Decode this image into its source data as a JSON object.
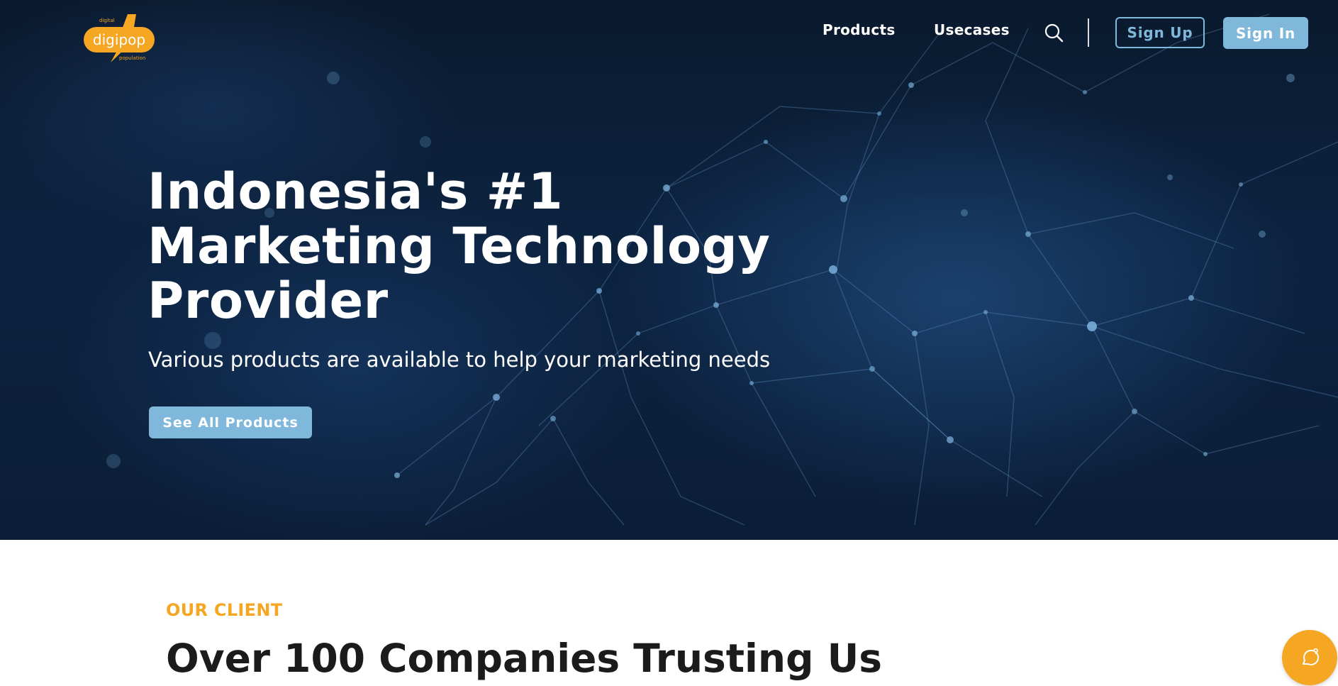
{
  "brand": {
    "logo_small_top": "digital",
    "logo_main": "digipop",
    "logo_small_bottom": "population"
  },
  "nav": {
    "links": [
      {
        "label": "Products"
      },
      {
        "label": "Usecases"
      }
    ],
    "search_icon": "search-icon",
    "signup_label": "Sign Up",
    "signin_label": "Sign In"
  },
  "hero": {
    "title_lines": [
      "Indonesia's #1",
      "Marketing Technology",
      "Provider"
    ],
    "subtitle": "Various products are available to help your marketing needs",
    "cta_label": "See All Products"
  },
  "clients": {
    "eyebrow": "OUR CLIENT",
    "title": "Over 100 Companies Trusting Us"
  },
  "chat": {
    "icon": "chat-bubble-icon"
  },
  "colors": {
    "accent_blue": "#7fb8da",
    "accent_orange": "#f5a623",
    "hero_bg": "#0c2340",
    "text_dark": "#1b1b1b"
  }
}
